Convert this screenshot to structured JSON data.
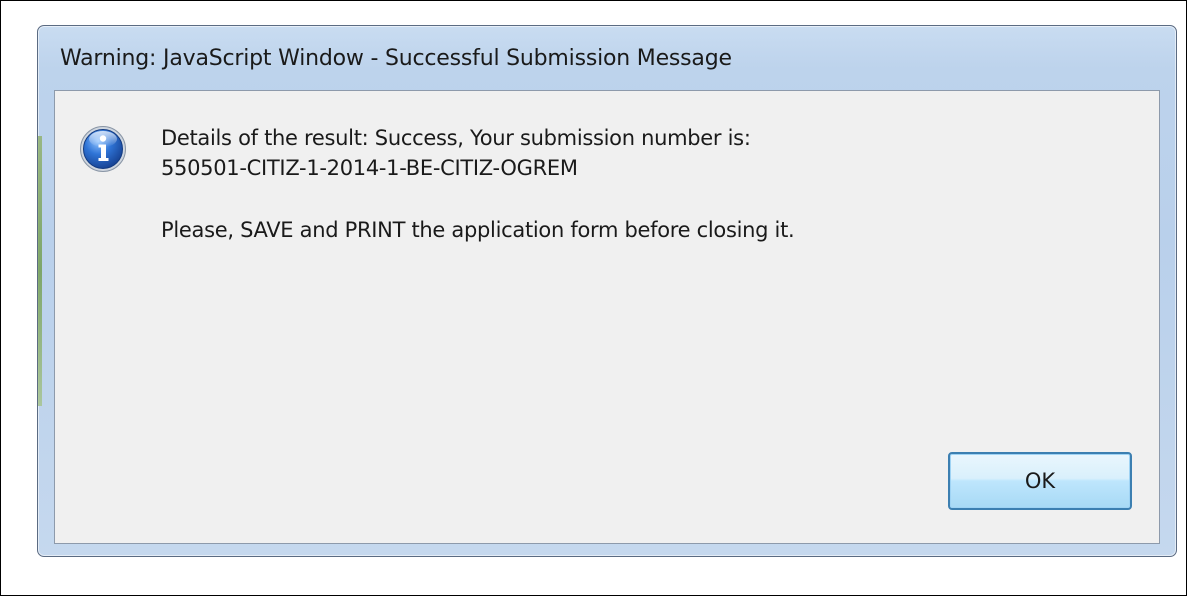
{
  "dialog": {
    "title": "Warning: JavaScript Window - Successful Submission Message",
    "icon": "info-icon",
    "message": {
      "line1": "Details of the result: Success, Your submission number is:",
      "line2": "550501-CITIZ-1-2014-1-BE-CITIZ-OGREM",
      "line3": "Please, SAVE and PRINT the application form before closing it."
    },
    "ok_label": "OK"
  },
  "colors": {
    "window_frame": "#b9d0eb",
    "client_background": "#f0f0f0",
    "ok_button_border": "#3c7fb1",
    "icon_blue": "#1f5fbf"
  }
}
